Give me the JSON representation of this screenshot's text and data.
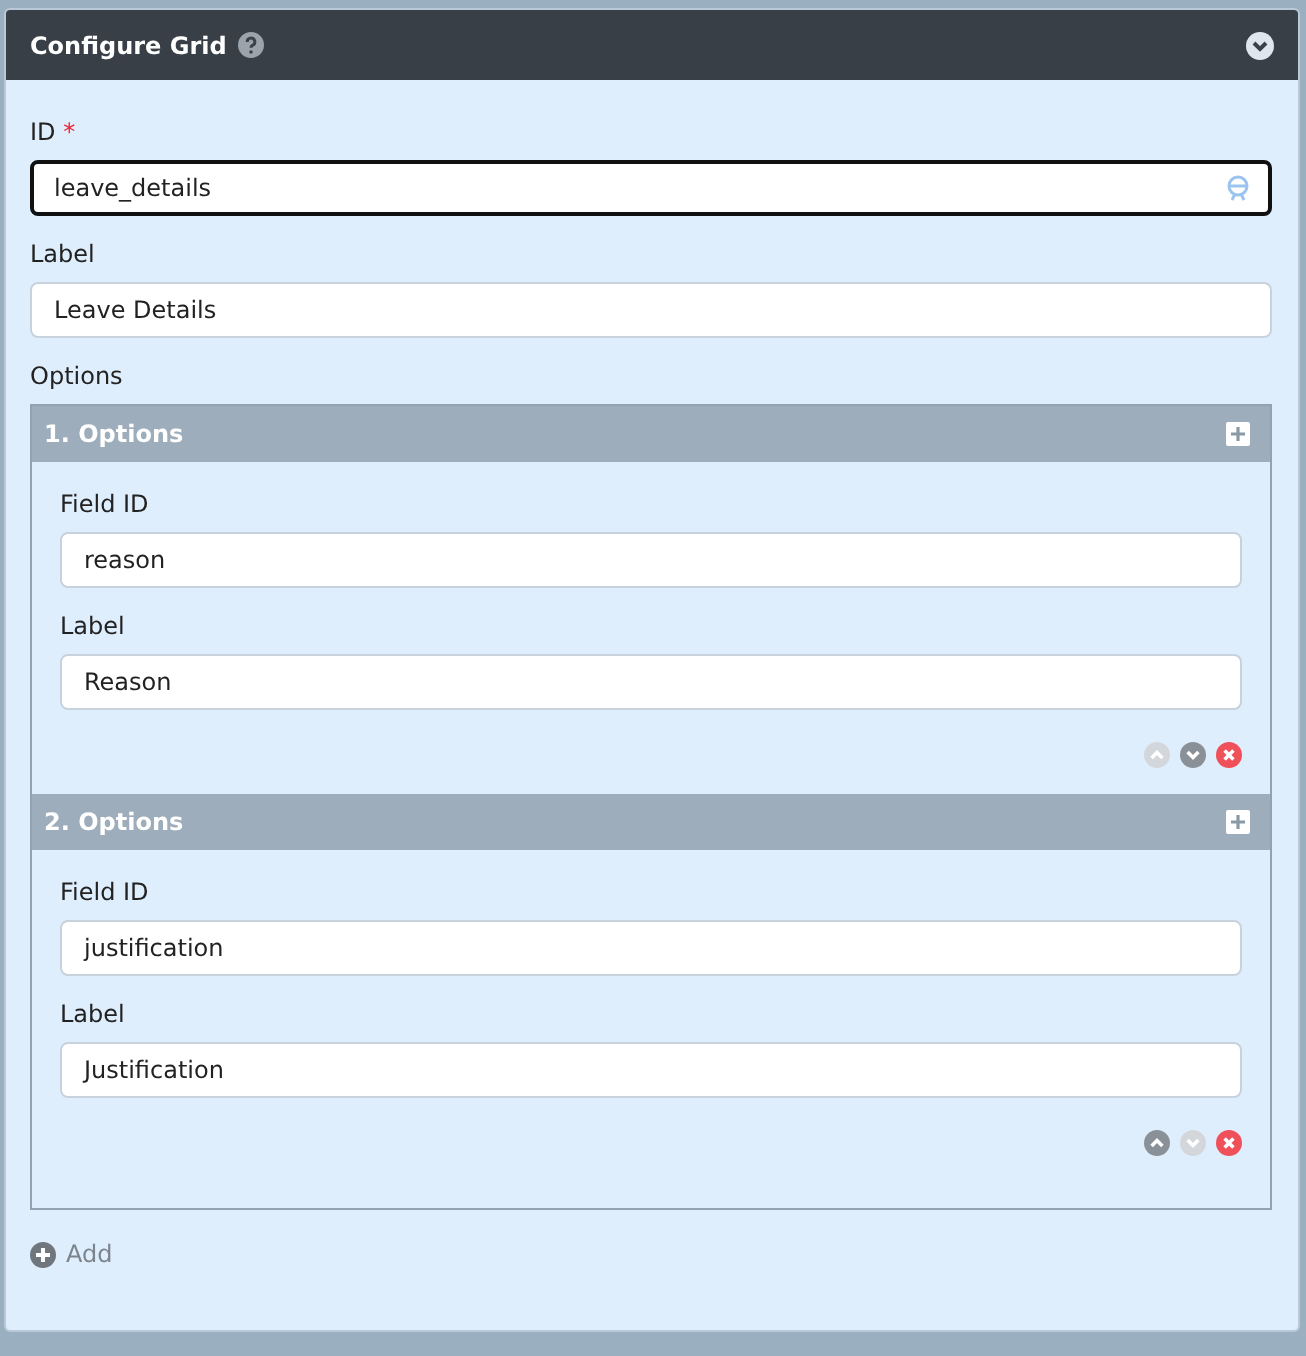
{
  "panel": {
    "title": "Configure Grid"
  },
  "id_field": {
    "label": "ID",
    "required_mark": "*",
    "value": "leave_details",
    "focused": true
  },
  "label_field": {
    "label": "Label",
    "value": "Leave Details"
  },
  "options": {
    "label": "Options",
    "items": [
      {
        "title": "1. Options",
        "fields": [
          {
            "label": "Field ID",
            "value": "reason"
          },
          {
            "label": "Label",
            "value": "Reason"
          }
        ],
        "up_disabled": true,
        "down_disabled": false
      },
      {
        "title": "2. Options",
        "fields": [
          {
            "label": "Field ID",
            "value": "justification"
          },
          {
            "label": "Label",
            "value": "Justification"
          }
        ],
        "up_disabled": false,
        "down_disabled": true
      }
    ]
  },
  "add_button": {
    "label": "Add"
  }
}
